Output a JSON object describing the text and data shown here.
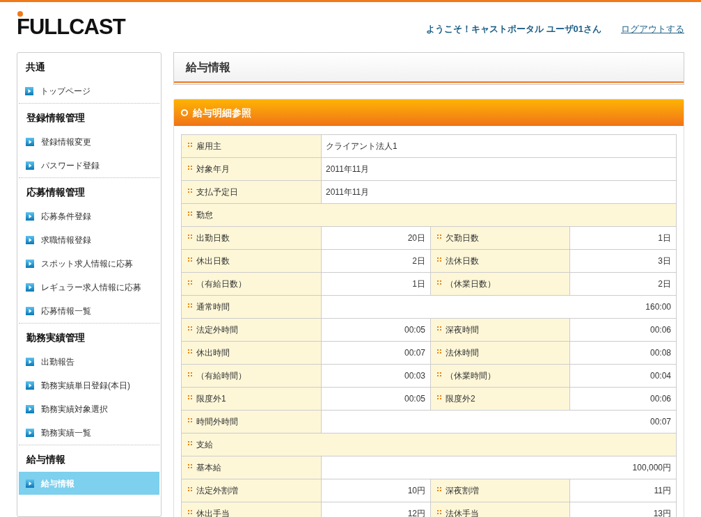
{
  "logo": "FULLCAST",
  "welcome": "ようこそ！キャストポータル ユーザ01さん",
  "logout": "ログアウトする",
  "sidebar": [
    {
      "heading": "共通",
      "items": [
        {
          "label": "トップページ",
          "selected": false
        }
      ]
    },
    {
      "heading": "登録情報管理",
      "items": [
        {
          "label": "登録情報変更",
          "selected": false
        },
        {
          "label": "パスワード登録",
          "selected": false
        }
      ]
    },
    {
      "heading": "応募情報管理",
      "items": [
        {
          "label": "応募条件登録",
          "selected": false
        },
        {
          "label": "求職情報登録",
          "selected": false
        },
        {
          "label": "スポット求人情報に応募",
          "selected": false
        },
        {
          "label": "レギュラー求人情報に応募",
          "selected": false
        },
        {
          "label": "応募情報一覧",
          "selected": false
        }
      ]
    },
    {
      "heading": "勤務実績管理",
      "items": [
        {
          "label": "出勤報告",
          "selected": false
        },
        {
          "label": "勤務実績単日登録(本日)",
          "selected": false
        },
        {
          "label": "勤務実績対象選択",
          "selected": false
        },
        {
          "label": "勤務実績一覧",
          "selected": false
        }
      ]
    },
    {
      "heading": "給与情報",
      "items": [
        {
          "label": "給与情報",
          "selected": true
        }
      ]
    }
  ],
  "page_title": "給与情報",
  "section_title": "給与明細参照",
  "rows": [
    {
      "kind": "text",
      "label": "雇用主",
      "value": "クライアント法人1"
    },
    {
      "kind": "text",
      "label": "対象年月",
      "value": "2011年11月"
    },
    {
      "kind": "text",
      "label": "支払予定日",
      "value": "2011年11月"
    },
    {
      "kind": "section",
      "label": "勤怠"
    },
    {
      "kind": "pair",
      "label": "出勤日数",
      "value": "20日",
      "label_2": "欠勤日数",
      "value_2": "1日"
    },
    {
      "kind": "pair",
      "label": "休出日数",
      "value": "2日",
      "label_2": "法休日数",
      "value_2": "3日"
    },
    {
      "kind": "pair",
      "label": "（有給日数）",
      "value": "1日",
      "label_2": "（休業日数）",
      "value_2": "2日"
    },
    {
      "kind": "total",
      "label": "通常時間",
      "value": "160:00"
    },
    {
      "kind": "pair",
      "label": "法定外時間",
      "value": "00:05",
      "label_2": "深夜時間",
      "value_2": "00:06"
    },
    {
      "kind": "pair",
      "label": "休出時間",
      "value": "00:07",
      "label_2": "法休時間",
      "value_2": "00:08"
    },
    {
      "kind": "pair",
      "label": "（有給時間）",
      "value": "00:03",
      "label_2": "（休業時間）",
      "value_2": "00:04"
    },
    {
      "kind": "pair",
      "label": "限度外1",
      "value": "00:05",
      "label_2": "限度外2",
      "value_2": "00:06"
    },
    {
      "kind": "total",
      "label": "時間外時間",
      "value": "00:07"
    },
    {
      "kind": "section",
      "label": "支給"
    },
    {
      "kind": "total",
      "label": "基本給",
      "value": "100,000円"
    },
    {
      "kind": "pair",
      "label": "法定外割増",
      "value": "10円",
      "label_2": "深夜割増",
      "value_2": "11円"
    },
    {
      "kind": "pair",
      "label": "休出手当",
      "value": "12円",
      "label_2": "法休手当",
      "value_2": "13円"
    }
  ]
}
